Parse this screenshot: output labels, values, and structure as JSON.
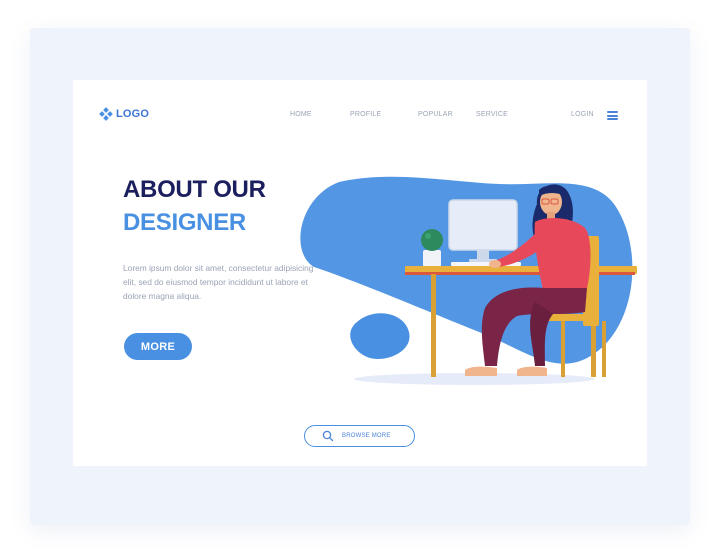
{
  "logo": {
    "text": "LOGO",
    "icon": "diamond-cluster-icon"
  },
  "nav": {
    "items": [
      {
        "label": "HOME"
      },
      {
        "label": "PROFILE"
      },
      {
        "label": "POPULAR"
      },
      {
        "label": "SERVICE"
      }
    ],
    "login_label": "LOGIN",
    "menu_icon": "hamburger-icon"
  },
  "hero": {
    "title_line1": "ABOUT OUR",
    "title_line2": "DESIGNER",
    "description": "Lorem ipsum dolor sit amet, consectetur adipisicing elit, sed do eiusmod tempor incididunt ut labore et dolore magna aliqua.",
    "more_label": "MORE"
  },
  "browse": {
    "label": "BROWSE MORE",
    "icon": "search-icon"
  },
  "illustration": {
    "subject": "woman working at desktop computer"
  },
  "colors": {
    "accent": "#4a90e2",
    "title_dark": "#1c1f5e",
    "frame_bg": "#eef3fc",
    "muted_text": "#9aa3b5"
  }
}
